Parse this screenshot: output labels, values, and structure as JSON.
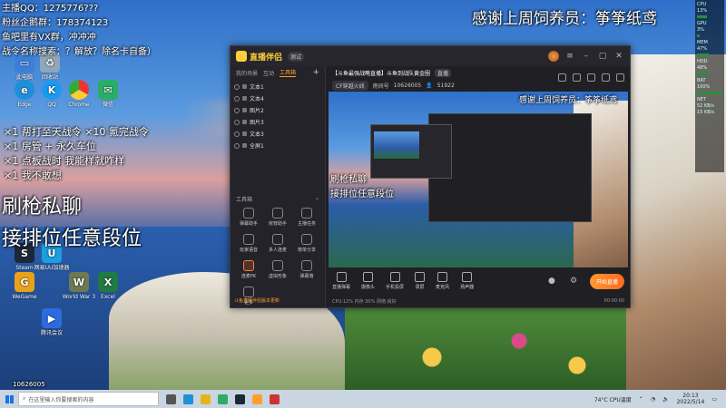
{
  "overlay": {
    "top_left_lines": [
      "主播QQ：1275776???",
      "粉丝企鹅群：178374123",
      "鱼吧里有VX群，冲冲冲",
      "战令名称搜索：？解放？除名卡自备）"
    ],
    "thanks_banner": "感谢上周饲养员：筝筝纸鸢",
    "mid_left_lines": [
      "×1 帮打至天战令 ×10 氪完战令",
      "×1 房管 + 永久车位",
      "×1 点板战时 我能样就咋样",
      "×1 我不敢想"
    ],
    "big_line_1": "刷枪私聊",
    "big_line_2": "接排位任意段位",
    "room_id_label": "10626005"
  },
  "app": {
    "logo": "直播伴侣",
    "version": "测试",
    "left_tabs": [
      "我的场景",
      "互动",
      "工具箱"
    ],
    "scenes": [
      "文本1",
      "文本4",
      "图片2",
      "图片3",
      "文本3",
      "全屏1"
    ],
    "tools_heading": "工具箱",
    "tools": [
      "弹幕助手",
      "房管助手",
      "主播任务",
      "玩家语音",
      "多人连麦",
      "榜单分享",
      "连麦PK",
      "虚拟形象",
      "弹幕墙",
      "更多",
      "",
      ""
    ],
    "notice": "斗鱼直播伴侣版本更新",
    "stream": {
      "title": "【斗鱼最强战略直播】斗鱼到战队黄金圈",
      "tag": "直播",
      "category": "CF穿越火线",
      "room_label": "房间号",
      "room_id": "10626005",
      "viewers": "51922"
    },
    "controls": [
      "直播弹幕",
      "摄像头",
      "手机投屏",
      "录屏",
      "麦克风",
      "扬声器"
    ],
    "go_live_label": "开始直播",
    "status_left": "CPU:12%  内存:30%  网络:良好",
    "status_right": "00:00:00"
  },
  "hw_monitor": {
    "lines": [
      "CPU",
      "13%",
      "GPU",
      "3%",
      "MEM",
      "47%",
      "HDD",
      "48%",
      "BAT",
      "100%",
      "NET",
      "52 KB/s",
      "15 KB/s"
    ]
  },
  "desktop_icons": [
    "此电脑",
    "回收站",
    "Steam",
    "网易UU加速器",
    "World War 3",
    "WeGame",
    "QQ",
    "Edge",
    "Chrome",
    "微信",
    "腾讯会议",
    "Excel"
  ],
  "taskbar": {
    "search_placeholder": "在这里输入你要搜索的内容",
    "weather": "74°C CPU温度",
    "time": "20:13",
    "date": "2022/5/14"
  },
  "colors": {
    "accent": "#ff9f2f",
    "window_bg": "#1f1f24"
  }
}
